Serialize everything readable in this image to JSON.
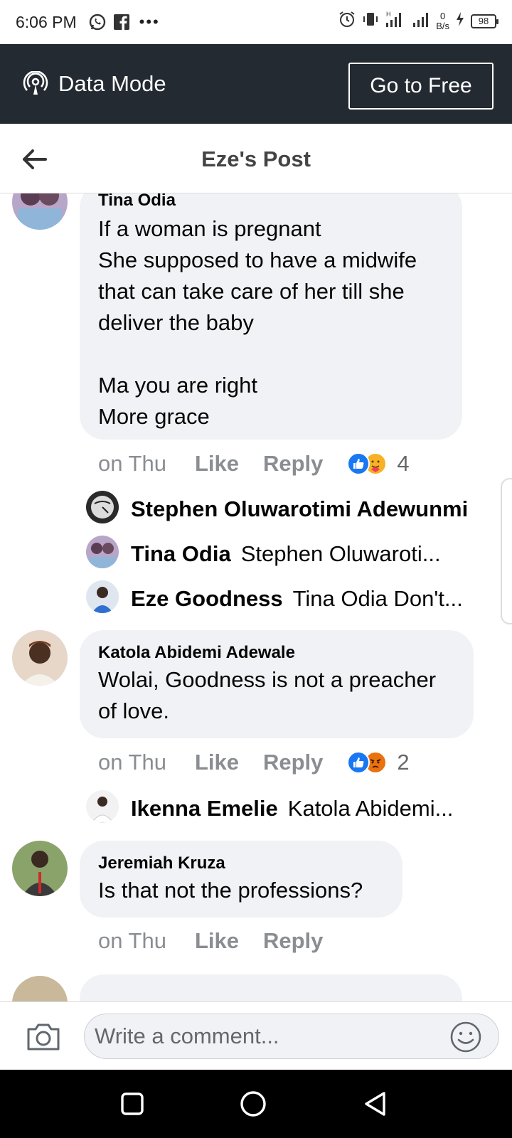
{
  "status_bar": {
    "time": "6:06 PM",
    "more": "•••",
    "net_speed_value": "0",
    "net_speed_unit": "B/s",
    "battery": "98"
  },
  "data_bar": {
    "mode_label": "Data Mode",
    "go_free_label": "Go to Free"
  },
  "header": {
    "title": "Eze's Post"
  },
  "comments": [
    {
      "author": "Tina Odia",
      "text": "If a woman is pregnant\nShe supposed  to have a midwife that can take care of her till she deliver the baby\n\nMa you are right\nMore grace",
      "time": "on Thu",
      "like_label": "Like",
      "reply_label": "Reply",
      "reaction_count": "4",
      "reactions": [
        "like",
        "care"
      ],
      "replies": [
        {
          "author": "Stephen Oluwarotimi Adewunmi",
          "text": ""
        },
        {
          "author": "Tina Odia",
          "text": "Stephen Oluwaroti..."
        },
        {
          "author": "Eze Goodness",
          "text": "Tina Odia Don't..."
        }
      ]
    },
    {
      "author": "Katola Abidemi Adewale",
      "text": "Wolai, Goodness is not a preacher of love.",
      "time": "on Thu",
      "like_label": "Like",
      "reply_label": "Reply",
      "reaction_count": "2",
      "reactions": [
        "like",
        "angry"
      ],
      "replies": [
        {
          "author": "Ikenna Emelie",
          "text": "Katola Abidemi..."
        }
      ]
    },
    {
      "author": "Jeremiah Kruza",
      "text": "Is that not the professions?",
      "time": "on Thu",
      "like_label": "Like",
      "reply_label": "Reply"
    }
  ],
  "composer": {
    "placeholder": "Write a comment..."
  },
  "icons": {
    "whatsapp": "whatsapp-icon",
    "facebook": "facebook-icon",
    "data_mode": "podcast-signal-icon",
    "back": "back-arrow-icon",
    "camera": "camera-icon",
    "emoji": "smiley-icon",
    "nav_recent": "square-icon",
    "nav_home": "circle-icon",
    "nav_back": "triangle-back-icon"
  },
  "colors": {
    "data_bar_bg": "#242a31",
    "bubble_bg": "#f0f2f5",
    "like_blue": "#1877f2",
    "meta_gray": "#8a8d91"
  }
}
